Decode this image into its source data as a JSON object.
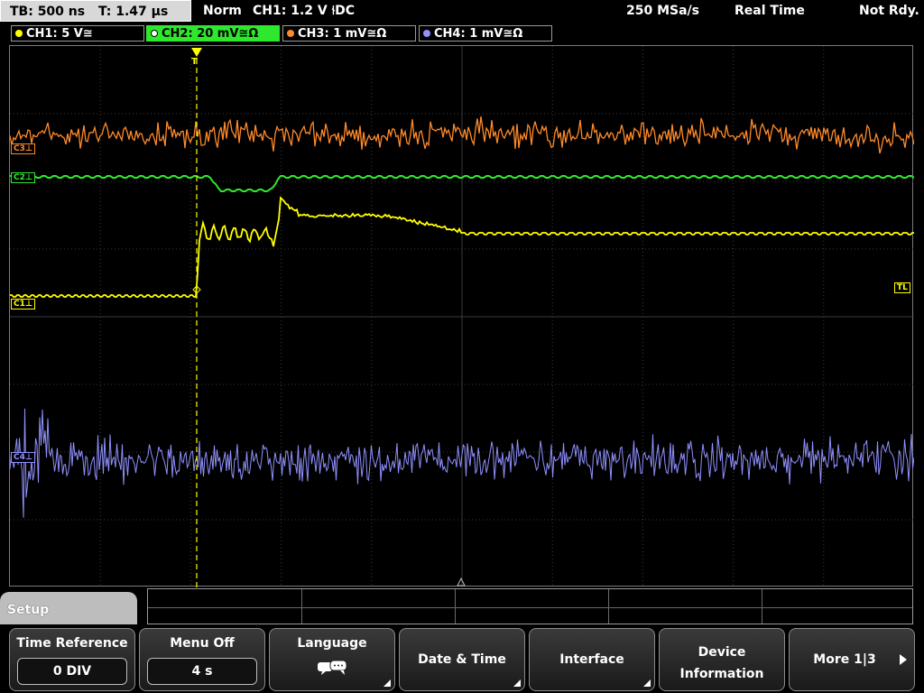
{
  "topbar": {
    "tb": "TB: 500 ns",
    "t": "T: 1.47 µs",
    "mode": "Norm",
    "trigger": "CH1: 1.2 V ⫮DC",
    "sample_rate": "250 MSa/s",
    "acq": "Real Time",
    "state": "Not Rdy."
  },
  "channels": [
    {
      "label": "CH1: 5 V≅",
      "color": "#ffff00"
    },
    {
      "label": "CH2: 20 mV≅Ω",
      "color": "#2ee82e"
    },
    {
      "label": "CH3: 1 mV≅Ω",
      "color": "#ff8a2a"
    },
    {
      "label": "CH4: 1 mV≅Ω",
      "color": "#9090ff"
    }
  ],
  "markers": {
    "c3": "C3⊥",
    "c2": "C2⊥",
    "c1": "C1⊥",
    "c4": "C4⊥",
    "tl": "TL",
    "trigger": "T"
  },
  "colors": {
    "ch1": "#ffff00",
    "ch2": "#2ee82e",
    "ch3": "#ff8a2a",
    "ch4": "#9090ff",
    "grid": "#3c3c3c"
  },
  "menu": {
    "title": "Setup",
    "keys": [
      {
        "label": "Time Reference",
        "value": "0 DIV"
      },
      {
        "label": "Menu Off",
        "value": "4 s"
      },
      {
        "label": "Language",
        "icon": "speech-bubble-icon"
      },
      {
        "label": "Date & Time"
      },
      {
        "label": "Interface"
      },
      {
        "label": "Device",
        "label2": "Information"
      },
      {
        "label": "More 1|3"
      }
    ]
  }
}
